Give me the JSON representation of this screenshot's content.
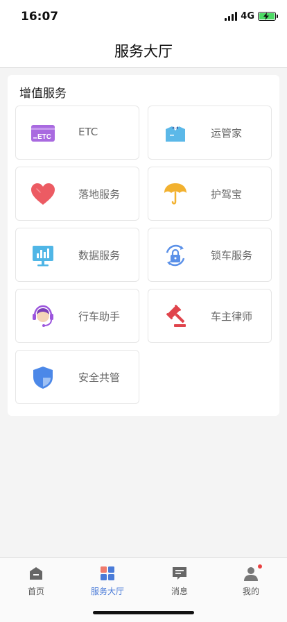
{
  "status_bar": {
    "time": "16:07",
    "network": "4G"
  },
  "nav": {
    "title": "服务大厅"
  },
  "section": {
    "title": "增值服务"
  },
  "services": [
    {
      "label": "ETC",
      "icon": "etc-card-icon",
      "badge_text": "ETC"
    },
    {
      "label": "运管家",
      "icon": "butler-icon"
    },
    {
      "label": "落地服务",
      "icon": "heart-icon"
    },
    {
      "label": "护驾宝",
      "icon": "umbrella-icon"
    },
    {
      "label": "数据服务",
      "icon": "data-monitor-icon"
    },
    {
      "label": "锁车服务",
      "icon": "lock-refresh-icon"
    },
    {
      "label": "行车助手",
      "icon": "headset-icon"
    },
    {
      "label": "车主律师",
      "icon": "gavel-icon"
    },
    {
      "label": "安全共管",
      "icon": "shield-icon"
    }
  ],
  "tabs": [
    {
      "label": "首页",
      "icon": "home-icon",
      "active": false
    },
    {
      "label": "服务大厅",
      "icon": "grid-icon",
      "active": true
    },
    {
      "label": "消息",
      "icon": "message-icon",
      "active": false
    },
    {
      "label": "我的",
      "icon": "person-icon",
      "active": false
    }
  ],
  "colors": {
    "active_tab": "#4a7bd8",
    "etc": "#a96ae0",
    "butler": "#5bb8e8",
    "heart": "#ec5b63",
    "umbrella": "#f2b12f",
    "data": "#50b6e6",
    "lock": "#5a90e8",
    "headset": "#9c55dd",
    "gavel": "#e0444c",
    "shield": "#4c88e8"
  }
}
